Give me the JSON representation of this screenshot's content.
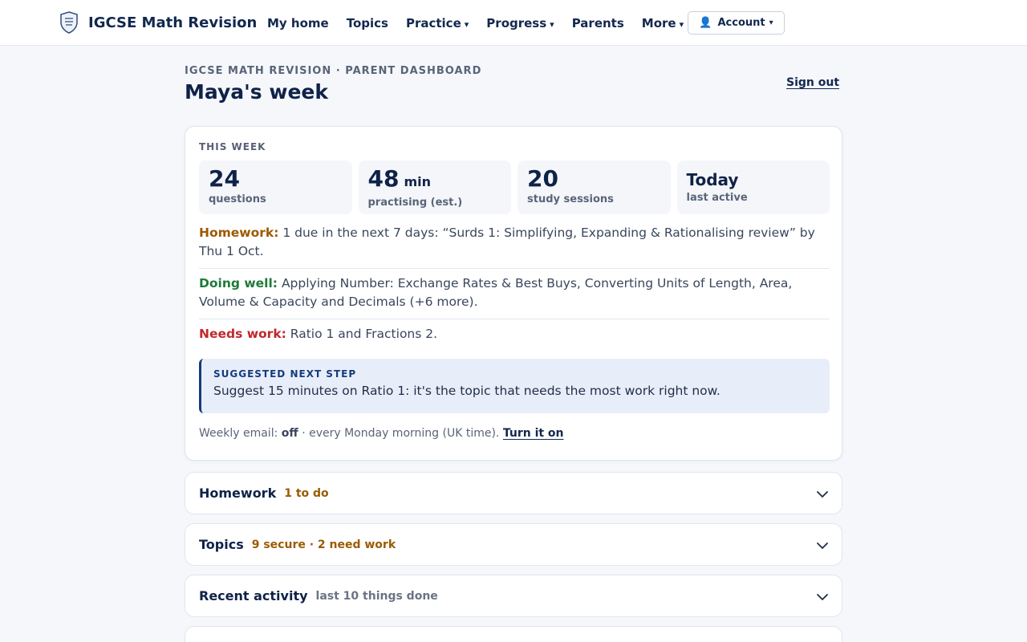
{
  "header": {
    "brand": "IGCSE Math Revision",
    "nav": [
      {
        "label": "My home",
        "caret": ""
      },
      {
        "label": "Topics",
        "caret": ""
      },
      {
        "label": "Practice",
        "caret": "▾"
      },
      {
        "label": "Progress",
        "caret": "▾"
      },
      {
        "label": "Parents",
        "caret": ""
      },
      {
        "label": "More",
        "caret": "▾"
      }
    ],
    "account": {
      "icon": "👤",
      "label": "Account",
      "caret": "▾"
    }
  },
  "page": {
    "eyebrow": "IGCSE MATH REVISION · PARENT DASHBOARD",
    "title": "Maya's week",
    "signout": "Sign out"
  },
  "summary": {
    "label": "THIS WEEK",
    "stats": [
      {
        "value": "24",
        "unit": "",
        "label": "questions"
      },
      {
        "value": "48",
        "unit": "min",
        "label": "practising (est.)"
      },
      {
        "value": "20",
        "unit": "",
        "label": "study sessions"
      },
      {
        "value": "Today",
        "unit": "",
        "label": "last active"
      }
    ],
    "homework": {
      "key": "Homework:",
      "text": "1 due in the next 7 days: “Surds 1: Simplifying, Expanding & Rationalising review” by Thu 1 Oct."
    },
    "doing_well": {
      "key": "Doing well:",
      "text": "Applying Number: Exchange Rates & Best Buys, Converting Units of Length, Area, Volume & Capacity and Decimals (+6 more)."
    },
    "needs_work": {
      "key": "Needs work:",
      "text": "Ratio 1 and Fractions 2."
    },
    "next_step": {
      "label": "SUGGESTED NEXT STEP",
      "text": "Suggest 15 minutes on Ratio 1: it's the topic that needs the most work right now."
    },
    "email": {
      "prefix": "Weekly email:",
      "status": "off",
      "suffix": "· every Monday morning (UK time).",
      "action": "Turn it on"
    }
  },
  "sections": [
    {
      "title": "Homework",
      "meta": "1 to do"
    },
    {
      "title": "Topics",
      "meta": "9 secure · 2 need work"
    },
    {
      "title": "Recent activity",
      "meta": "last 10 things done"
    }
  ],
  "colors": {
    "navy": "#0f2248",
    "amber": "#9a5b00",
    "green": "#1f7a3a",
    "red": "#c0282d",
    "page_bg": "#f5f7fb"
  },
  "icons": {
    "logo": "shield-logo-icon",
    "account": "person-icon",
    "chevron": "chevron-down-icon"
  }
}
